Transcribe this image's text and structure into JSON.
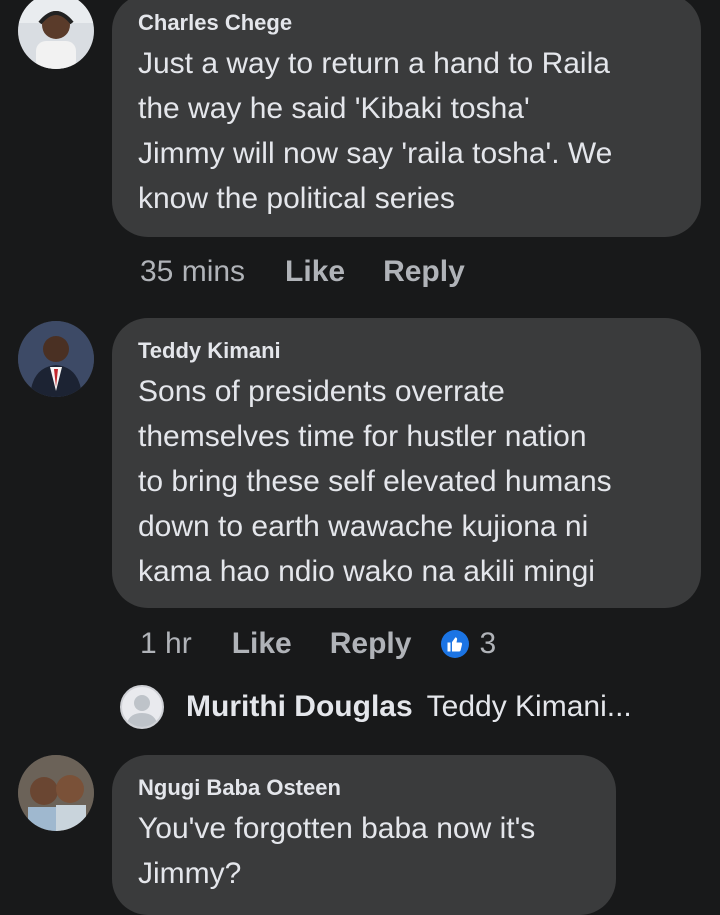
{
  "comments": [
    {
      "author": "Charles Chege",
      "text": "Just a way to return a hand to Raila\nthe way he said 'Kibaki tosha'\nJimmy will now say 'raila tosha'. We\nknow the political series",
      "time": "35 mins",
      "like_label": "Like",
      "reply_label": "Reply"
    },
    {
      "author": "Teddy Kimani",
      "text": "Sons of presidents overrate\nthemselves time for hustler nation\nto bring these self elevated humans\ndown to earth wawache kujiona ni\nkama hao ndio wako na akili mingi",
      "time": "1 hr",
      "like_label": "Like",
      "reply_label": "Reply",
      "reaction_count": "3",
      "reply_preview": {
        "author": "Murithi Douglas",
        "snippet": "Teddy Kimani..."
      }
    },
    {
      "author": "Ngugi Baba Osteen",
      "text": "You've forgotten baba now it's\nJimmy?"
    }
  ],
  "colors": {
    "background": "#18191a",
    "bubble": "#3a3b3c",
    "primary_text": "#e4e6eb",
    "secondary_text": "#b0b3b8",
    "like_badge": "#1b74e4"
  },
  "icons": {
    "reaction": "thumbs-up-icon"
  }
}
